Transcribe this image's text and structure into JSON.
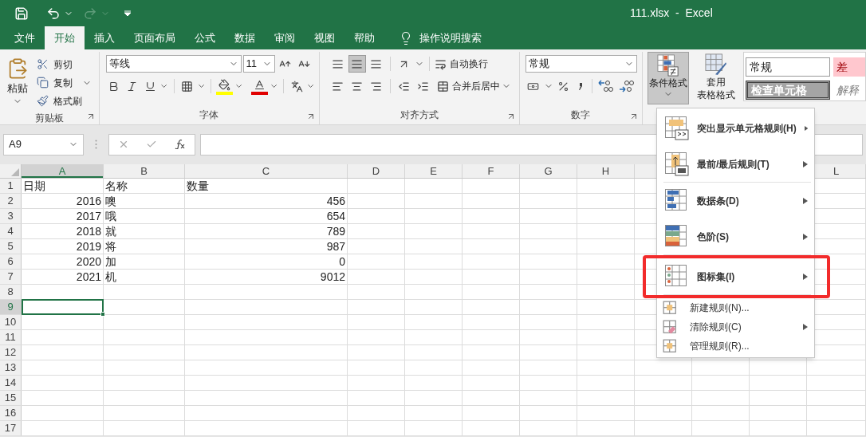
{
  "title_bar": {
    "title": "111.xlsx  -  Excel"
  },
  "tabs": [
    {
      "label": "文件",
      "selected": false
    },
    {
      "label": "开始",
      "selected": true
    },
    {
      "label": "插入",
      "selected": false
    },
    {
      "label": "页面布局",
      "selected": false
    },
    {
      "label": "公式",
      "selected": false
    },
    {
      "label": "数据",
      "selected": false
    },
    {
      "label": "审阅",
      "selected": false
    },
    {
      "label": "视图",
      "selected": false
    },
    {
      "label": "帮助",
      "selected": false
    }
  ],
  "tell_me": {
    "label": "操作说明搜索"
  },
  "ribbon": {
    "clipboard": {
      "paste": "粘贴",
      "actions": [
        "剪切",
        "复制",
        "格式刷"
      ],
      "label": "剪贴板"
    },
    "font": {
      "font_name": "等线",
      "font_size": "11",
      "label": "字体"
    },
    "alignment": {
      "actions": [
        "自动换行",
        "合并后居中"
      ],
      "label": "对齐方式"
    },
    "number": {
      "format": "常规",
      "label": "数字"
    },
    "styles": {
      "conditional_formatting": {
        "label": "条件格式",
        "pressed": true
      },
      "format_as_table": [
        "套用",
        "表格格式"
      ],
      "cell_styles": [
        {
          "label": "常规",
          "kind": "normal"
        },
        {
          "label": "差",
          "kind": "bad"
        },
        {
          "label": "检查单元格",
          "kind": "check"
        },
        {
          "label": "解释",
          "kind": "explanatory"
        }
      ]
    }
  },
  "formula_bar": {
    "name_box": "A9"
  },
  "sheet": {
    "columns": [
      {
        "label": "A",
        "selected": true
      },
      {
        "label": "B",
        "selected": false
      },
      {
        "label": "C",
        "selected": false
      },
      {
        "label": "D",
        "selected": false
      },
      {
        "label": "E",
        "selected": false
      },
      {
        "label": "F",
        "selected": false
      },
      {
        "label": "G",
        "selected": false
      },
      {
        "label": "H",
        "selected": false
      },
      {
        "label": "L",
        "selected": false
      }
    ],
    "rows": [
      {
        "number": "1",
        "selected": false,
        "cells": [
          {
            "value": "日期",
            "kind": "text"
          },
          {
            "value": "名称",
            "kind": "text"
          },
          {
            "value": "数量",
            "kind": "text"
          }
        ]
      },
      {
        "number": "2",
        "selected": false,
        "cells": [
          {
            "value": "2016",
            "kind": "number"
          },
          {
            "value": "噢",
            "kind": "text"
          },
          {
            "value": "456",
            "kind": "number"
          }
        ]
      },
      {
        "number": "3",
        "selected": false,
        "cells": [
          {
            "value": "2017",
            "kind": "number"
          },
          {
            "value": "哦",
            "kind": "text"
          },
          {
            "value": "654",
            "kind": "number"
          }
        ]
      },
      {
        "number": "4",
        "selected": false,
        "cells": [
          {
            "value": "2018",
            "kind": "number"
          },
          {
            "value": "就",
            "kind": "text"
          },
          {
            "value": "789",
            "kind": "number"
          }
        ]
      },
      {
        "number": "5",
        "selected": false,
        "cells": [
          {
            "value": "2019",
            "kind": "number"
          },
          {
            "value": "将",
            "kind": "text"
          },
          {
            "value": "987",
            "kind": "number"
          }
        ]
      },
      {
        "number": "6",
        "selected": false,
        "cells": [
          {
            "value": "2020",
            "kind": "number"
          },
          {
            "value": "加",
            "kind": "text"
          },
          {
            "value": "0",
            "kind": "number"
          }
        ]
      },
      {
        "number": "7",
        "selected": false,
        "cells": [
          {
            "value": "2021",
            "kind": "number"
          },
          {
            "value": "机",
            "kind": "text"
          },
          {
            "value": "9012",
            "kind": "number"
          }
        ]
      },
      {
        "number": "8",
        "selected": false
      },
      {
        "number": "9",
        "selected": true
      },
      {
        "number": "10",
        "selected": false
      },
      {
        "number": "11",
        "selected": false
      },
      {
        "number": "12",
        "selected": false
      },
      {
        "number": "13",
        "selected": false
      },
      {
        "number": "14",
        "selected": false
      },
      {
        "number": "15",
        "selected": false
      },
      {
        "number": "16",
        "selected": false
      },
      {
        "number": "17",
        "selected": false
      }
    ]
  },
  "menu": {
    "items": [
      {
        "label": "突出显示单元格规则(H)",
        "kind": "large",
        "submenu": true,
        "separator_after": false,
        "highlighted": false
      },
      {
        "label": "最前/最后规则(T)",
        "kind": "large",
        "submenu": true,
        "separator_after": true,
        "highlighted": false
      },
      {
        "label": "数据条(D)",
        "kind": "large",
        "submenu": true,
        "separator_after": false,
        "highlighted": false
      },
      {
        "label": "色阶(S)",
        "kind": "large",
        "submenu": true,
        "separator_after": true,
        "highlighted": false
      },
      {
        "label": "图标集(I)",
        "kind": "large",
        "submenu": true,
        "separator_after": true,
        "highlighted": true
      },
      {
        "label": "新建规则(N)...",
        "kind": "small",
        "submenu": false,
        "separator_after": false,
        "highlighted": false
      },
      {
        "label": "清除规则(C)",
        "kind": "small",
        "submenu": true,
        "separator_after": false,
        "highlighted": false
      },
      {
        "label": "管理规则(R)...",
        "kind": "small",
        "submenu": false,
        "separator_after": false,
        "highlighted": false
      }
    ]
  }
}
